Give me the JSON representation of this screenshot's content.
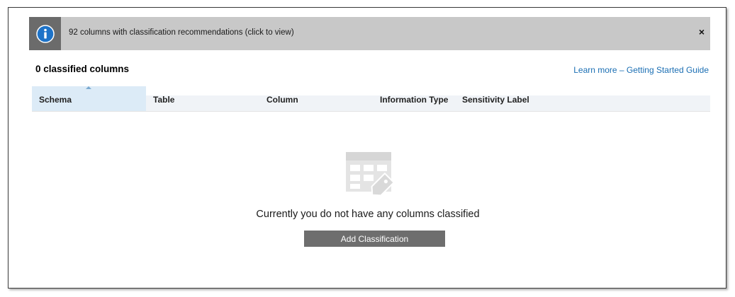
{
  "banner": {
    "text": "92 columns with classification recommendations (click to view)",
    "close_label": "×",
    "icon": "info-icon"
  },
  "heading": "0 classified columns",
  "learn_more": "Learn more – Getting Started Guide",
  "grid": {
    "columns": [
      "Schema",
      "Table",
      "Column",
      "Information Type",
      "Sensitivity Label"
    ],
    "sorted_column": "Schema",
    "sort_direction": "ascending"
  },
  "empty_state": {
    "icon": "table-tag-icon",
    "message": "Currently you do not have any columns classified",
    "button_label": "Add Classification"
  },
  "colors": {
    "banner_bg": "#c8c8c8",
    "icon_box_bg": "#6b6b6b",
    "info_blue": "#1e73c8",
    "link": "#1a6eb3",
    "button_bg": "#6e6e6e",
    "sorted_header_bg": "#dcebf7"
  }
}
